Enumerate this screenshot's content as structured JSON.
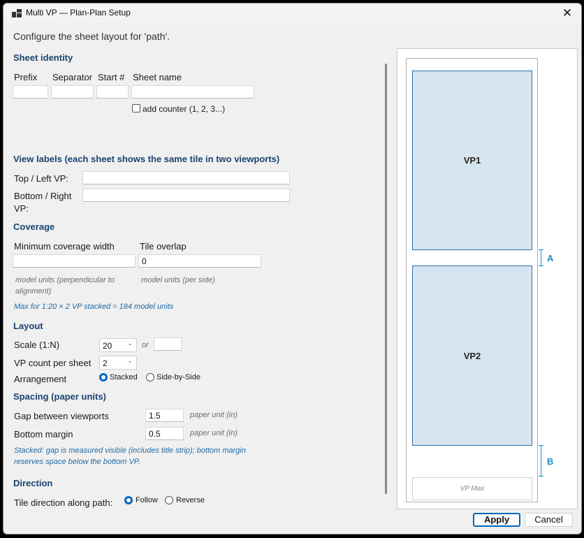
{
  "window": {
    "title": "Multi VP — Plan-Plan Setup",
    "close_glyph": "✕"
  },
  "intro": "Configure the sheet layout for 'path'.",
  "sheet_identity": {
    "heading": "Sheet identity",
    "prefix_label": "Prefix",
    "separator_label": "Separator",
    "start_label": "Start #",
    "sheet_name_label": "Sheet name",
    "prefix_value": "",
    "separator_value": "",
    "start_value": "",
    "sheet_name_value": "",
    "add_counter_label": "add counter (1, 2, 3...)",
    "add_counter_checked": false
  },
  "view_labels": {
    "heading": "View labels  (each sheet shows the same tile in two viewports)",
    "top_left_label": "Top / Left VP:",
    "bottom_right_label_line1": "Bottom / Right",
    "bottom_right_label_line2": "VP:",
    "top_left_value": "",
    "bottom_right_value": ""
  },
  "coverage": {
    "heading": "Coverage",
    "min_width_label": "Minimum coverage width",
    "overlap_label": "Tile overlap",
    "min_width_value": "",
    "overlap_value": "0",
    "min_width_hint_line1": "model units (perpendicular to",
    "min_width_hint_line2": "alignment)",
    "overlap_hint": "model units (per side)",
    "max_note": "Max for 1:20 × 2 VP stacked = 184 model units"
  },
  "layout": {
    "heading": "Layout",
    "scale_label": "Scale (1:N)",
    "scale_value": "20",
    "or_label": "or",
    "scale_custom_value": "",
    "vp_count_label": "VP count per sheet",
    "vp_count_value": "2",
    "arrangement_label": "Arrangement",
    "option_stacked": "Stacked",
    "option_side": "Side-by-Side",
    "selected": "Stacked"
  },
  "spacing": {
    "heading": "Spacing (paper units)",
    "gap_label": "Gap between viewports",
    "gap_value": "1.5",
    "gap_unit": "paper unit (in)",
    "margin_label": "Bottom margin",
    "margin_value": "0.5",
    "margin_unit": "paper unit (in)",
    "note_line1": "Stacked: gap is measured visible (includes title strip); bottom margin",
    "note_line2": "reserves space below the bottom VP."
  },
  "direction": {
    "heading": "Direction",
    "label": "Tile direction along path:",
    "option_follow": "Follow",
    "option_reverse": "Reverse",
    "selected": "Follow"
  },
  "preview": {
    "vp1_label": "VP1",
    "vp2_label": "VP2",
    "gap_marker": "A",
    "margin_marker": "B",
    "vpmax_label": "VP Max",
    "accent_color": "#1c8bc2",
    "vp_fill_color": "#d6e5ef"
  },
  "buttons": {
    "apply": "Apply",
    "cancel": "Cancel"
  }
}
